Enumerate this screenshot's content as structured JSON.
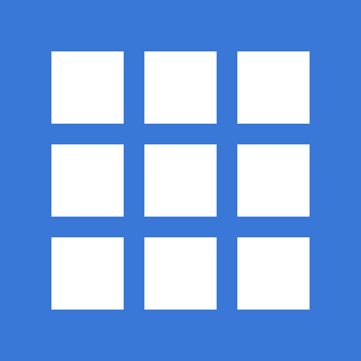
{
  "icon": {
    "name": "grid-icon",
    "background_color": "#3a78d8",
    "tile_color": "#ffffff",
    "rows": 3,
    "columns": 3
  }
}
